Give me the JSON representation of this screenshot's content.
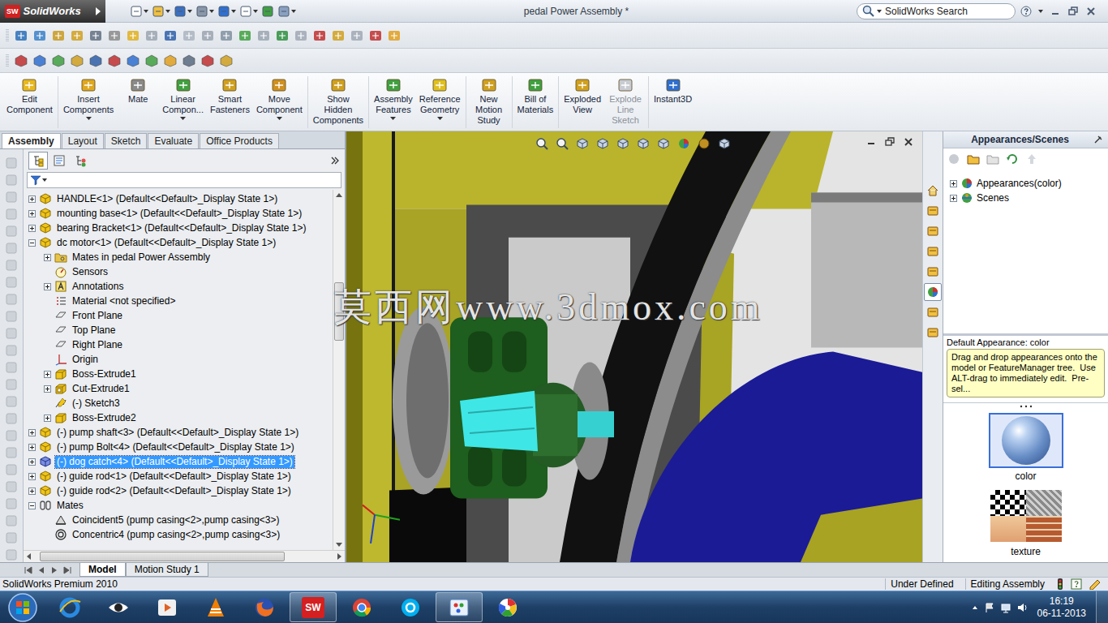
{
  "app": {
    "name": "SolidWorks",
    "mark": "SW"
  },
  "window": {
    "title": "pedal Power Assembly *"
  },
  "search": {
    "placeholder": "SolidWorks Search"
  },
  "command_groups": [
    [
      {
        "label": "Edit Component",
        "has_menu": false,
        "disabled": false
      }
    ],
    [
      {
        "label": "Insert Components",
        "has_menu": true,
        "disabled": false
      },
      {
        "label": "Mate",
        "has_menu": false,
        "disabled": false
      },
      {
        "label": "Linear Compon...",
        "has_menu": true,
        "disabled": false
      },
      {
        "label": "Smart Fasteners",
        "has_menu": false,
        "disabled": false
      },
      {
        "label": "Move Component",
        "has_menu": true,
        "disabled": false
      }
    ],
    [
      {
        "label": "Show Hidden Components",
        "has_menu": false,
        "disabled": false
      }
    ],
    [
      {
        "label": "Assembly Features",
        "has_menu": true,
        "disabled": false
      },
      {
        "label": "Reference Geometry",
        "has_menu": true,
        "disabled": false
      }
    ],
    [
      {
        "label": "New Motion Study",
        "has_menu": false,
        "disabled": false
      }
    ],
    [
      {
        "label": "Bill of Materials",
        "has_menu": false,
        "disabled": false
      }
    ],
    [
      {
        "label": "Exploded View",
        "has_menu": false,
        "disabled": false
      },
      {
        "label": "Explode Line Sketch",
        "has_menu": false,
        "disabled": true
      }
    ],
    [
      {
        "label": "Instant3D",
        "has_menu": false,
        "disabled": false
      }
    ]
  ],
  "tabs": [
    {
      "label": "Assembly",
      "selected": true
    },
    {
      "label": "Layout",
      "selected": false
    },
    {
      "label": "Sketch",
      "selected": false
    },
    {
      "label": "Evaluate",
      "selected": false
    },
    {
      "label": "Office Products",
      "selected": false
    }
  ],
  "panel_tabs": [
    {
      "kind": "feature-manager",
      "selected": true
    },
    {
      "kind": "property-manager",
      "selected": false
    },
    {
      "kind": "configuration-manager",
      "selected": false
    }
  ],
  "feature_tree": {
    "items": [
      {
        "label": "HANDLE<1> (Default<<Default>_Display State 1>)",
        "level": 0,
        "kind": "part",
        "expandable": true,
        "expanded": false,
        "selected": false
      },
      {
        "label": "mounting base<1> (Default<<Default>_Display State 1>)",
        "level": 0,
        "kind": "part",
        "expandable": true,
        "expanded": false,
        "selected": false
      },
      {
        "label": "bearing Bracket<1> (Default<<Default>_Display State 1>)",
        "level": 0,
        "kind": "part",
        "expandable": true,
        "expanded": false,
        "selected": false
      },
      {
        "label": "dc motor<1> (Default<<Default>_Display State 1>)",
        "level": 0,
        "kind": "part",
        "expandable": true,
        "expanded": true,
        "selected": false
      },
      {
        "label": "Mates in pedal Power Assembly",
        "level": 1,
        "kind": "folder",
        "expandable": true,
        "expanded": false,
        "selected": false
      },
      {
        "label": "Sensors",
        "level": 1,
        "kind": "sensor",
        "expandable": false,
        "expanded": false,
        "selected": false
      },
      {
        "label": "Annotations",
        "level": 1,
        "kind": "annotation",
        "expandable": true,
        "expanded": false,
        "selected": false
      },
      {
        "label": "Material <not specified>",
        "level": 1,
        "kind": "material",
        "expandable": false,
        "expanded": false,
        "selected": false
      },
      {
        "label": "Front Plane",
        "level": 1,
        "kind": "plane",
        "expandable": false,
        "expanded": false,
        "selected": false
      },
      {
        "label": "Top Plane",
        "level": 1,
        "kind": "plane",
        "expandable": false,
        "expanded": false,
        "selected": false
      },
      {
        "label": "Right Plane",
        "level": 1,
        "kind": "plane",
        "expandable": false,
        "expanded": false,
        "selected": false
      },
      {
        "label": "Origin",
        "level": 1,
        "kind": "origin",
        "expandable": false,
        "expanded": false,
        "selected": false
      },
      {
        "label": "Boss-Extrude1",
        "level": 1,
        "kind": "feature",
        "expandable": true,
        "expanded": false,
        "selected": false
      },
      {
        "label": "Cut-Extrude1",
        "level": 1,
        "kind": "cut",
        "expandable": true,
        "expanded": false,
        "selected": false
      },
      {
        "label": "(-) Sketch3",
        "level": 1,
        "kind": "sketch",
        "expandable": false,
        "expanded": false,
        "selected": false
      },
      {
        "label": "Boss-Extrude2",
        "level": 1,
        "kind": "feature",
        "expandable": true,
        "expanded": false,
        "selected": false
      },
      {
        "label": "(-) pump shaft<3> (Default<<Default>_Display State 1>)",
        "level": 0,
        "kind": "part",
        "expandable": true,
        "expanded": false,
        "selected": false
      },
      {
        "label": "(-) pump Bolt<4> (Default<<Default>_Display State 1>)",
        "level": 0,
        "kind": "part",
        "expandable": true,
        "expanded": false,
        "selected": false
      },
      {
        "label": "(-) dog catch<4> (Default<<Default>_Display State 1>)",
        "level": 0,
        "kind": "part",
        "expandable": true,
        "expanded": false,
        "selected": true
      },
      {
        "label": "(-) guide rod<1> (Default<<Default>_Display State 1>)",
        "level": 0,
        "kind": "part",
        "expandable": true,
        "expanded": false,
        "selected": false
      },
      {
        "label": "(-) guide rod<2> (Default<<Default>_Display State 1>)",
        "level": 0,
        "kind": "part",
        "expandable": true,
        "expanded": false,
        "selected": false
      },
      {
        "label": "Mates",
        "level": 0,
        "kind": "mates",
        "expandable": true,
        "expanded": true,
        "selected": false
      },
      {
        "label": "Coincident5 (pump casing<2>,pump casing<3>)",
        "level": 1,
        "kind": "coincident",
        "expandable": false,
        "expanded": false,
        "selected": false
      },
      {
        "label": "Concentric4 (pump casing<2>,pump casing<3>)",
        "level": 1,
        "kind": "concentric",
        "expandable": false,
        "expanded": false,
        "selected": false
      }
    ]
  },
  "bottom_tabs": [
    {
      "label": "Model",
      "selected": true
    },
    {
      "label": "Motion Study 1",
      "selected": false
    }
  ],
  "viewport": {
    "watermark": "莫西网www.3dmox.com"
  },
  "task_tabs": [
    {
      "kind": "home",
      "selected": false
    },
    {
      "kind": "design-library",
      "selected": false
    },
    {
      "kind": "file-explorer",
      "selected": false
    },
    {
      "kind": "search-results",
      "selected": false
    },
    {
      "kind": "view-palette",
      "selected": false
    },
    {
      "kind": "appearances",
      "selected": true
    },
    {
      "kind": "custom-properties",
      "selected": false
    },
    {
      "kind": "forum",
      "selected": false
    }
  ],
  "task_pane": {
    "title": "Appearances/Scenes",
    "tree": [
      {
        "label": "Appearances(color)",
        "kind": "appearances",
        "expanded": false
      },
      {
        "label": "Scenes",
        "kind": "scenes",
        "expanded": false
      }
    ],
    "caption": "Default Appearance: color",
    "tooltip": "Drag and drop appearances onto the model or FeatureManager tree.  Use ALT-drag to immediately edit.  Pre-sel...",
    "thumbnails": [
      {
        "label": "color",
        "kind": "color",
        "selected": true
      },
      {
        "label": "texture",
        "kind": "texture",
        "selected": false
      }
    ]
  },
  "status_bar": {
    "product": "SolidWorks Premium 2010",
    "fields": [
      "Under Defined",
      "Editing Assembly"
    ]
  },
  "taskbar": {
    "apps": [
      {
        "kind": "internet-explorer",
        "running": false
      },
      {
        "kind": "eye",
        "running": false
      },
      {
        "kind": "media-player",
        "running": false
      },
      {
        "kind": "vlc",
        "running": false
      },
      {
        "kind": "firefox",
        "running": false
      },
      {
        "kind": "solidworks",
        "running": true
      },
      {
        "kind": "chrome",
        "running": false
      },
      {
        "kind": "skype",
        "running": false
      },
      {
        "kind": "paint",
        "running": true
      },
      {
        "kind": "picasa",
        "running": false
      }
    ],
    "time": "16:19",
    "date": "06-11-2013"
  }
}
